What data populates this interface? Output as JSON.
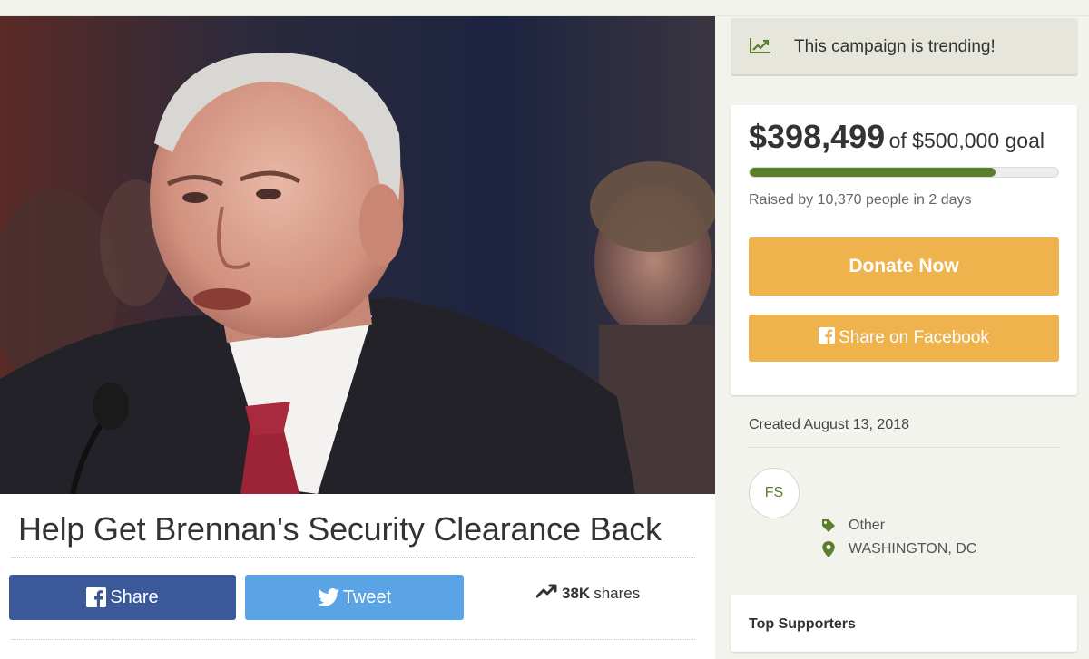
{
  "campaign": {
    "title": "Help Get Brennan's Security Clearance Back",
    "trending_text": "This campaign is trending!",
    "raised": "$398,499",
    "goal_text": "of $500,000 goal",
    "progress_fraction": 0.797,
    "raised_by": "Raised by 10,370 people in 2 days",
    "donate_label": "Donate Now",
    "share_facebook_label": "Share on Facebook",
    "created": "Created August 13, 2018",
    "organizer_initials": "FS",
    "category": "Other",
    "location": "WASHINGTON, DC",
    "top_supporters_label": "Top Supporters"
  },
  "social": {
    "share_label": "Share",
    "tweet_label": "Tweet",
    "share_count": "38K",
    "shares_word": "shares"
  },
  "colors": {
    "facebook": "#3b5998",
    "twitter": "#5aa4e6",
    "donate": "#efb34e",
    "progress": "#5a7f2b",
    "accent_green": "#5a7f2b",
    "page_bg": "#f3f3ee"
  },
  "icons": {
    "trending": "trending-chart-icon",
    "facebook": "facebook-icon",
    "twitter": "twitter-bird-icon",
    "shares": "trending-arrow-icon",
    "category": "tag-icon",
    "location": "map-pin-icon"
  }
}
